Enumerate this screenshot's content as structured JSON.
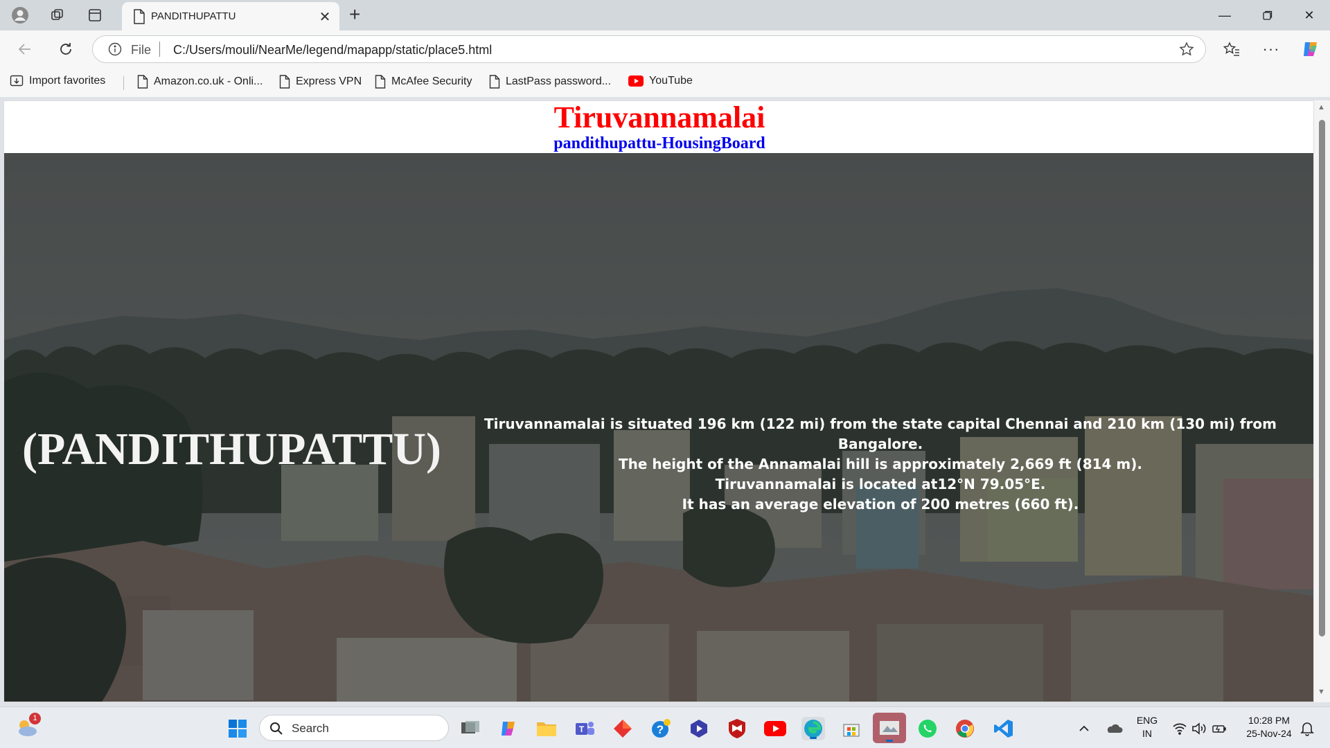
{
  "browser": {
    "tab": {
      "title": "PANDITHUPATTU"
    },
    "address": {
      "scheme_label": "File",
      "url": "C:/Users/mouli/NearMe/legend/mapapp/static/place5.html"
    },
    "favorites": [
      {
        "label": "Import favorites",
        "icon": "import-icon"
      },
      {
        "label": "Amazon.co.uk - Onli...",
        "icon": "page-icon"
      },
      {
        "label": "Express VPN",
        "icon": "page-icon"
      },
      {
        "label": "McAfee Security",
        "icon": "page-icon"
      },
      {
        "label": "LastPass password...",
        "icon": "page-icon"
      },
      {
        "label": "YouTube",
        "icon": "youtube-icon"
      }
    ]
  },
  "page": {
    "title": "Tiruvannamalai",
    "subtitle": "pandithupattu-HousingBoard",
    "hero_name": "(PANDITHUPATTU)",
    "info_lines": [
      "Tiruvannamalai is situated 196 km (122 mi) from the state capital Chennai and 210 km (130 mi) from Bangalore.",
      "The height of the Annamalai hill is approximately 2,669 ft (814 m).",
      "Tiruvannamalai is located at12°N 79.05°E.",
      "It has an average elevation of 200 metres (660 ft)."
    ]
  },
  "taskbar": {
    "search_placeholder": "Search",
    "weather_badge": "1",
    "language": {
      "line1": "ENG",
      "line2": "IN"
    },
    "clock": {
      "time": "10:28 PM",
      "date": "25-Nov-24"
    }
  },
  "colors": {
    "title_red": "#ff0000",
    "subtitle_blue": "#0000ee",
    "accent": "#0067c0"
  }
}
